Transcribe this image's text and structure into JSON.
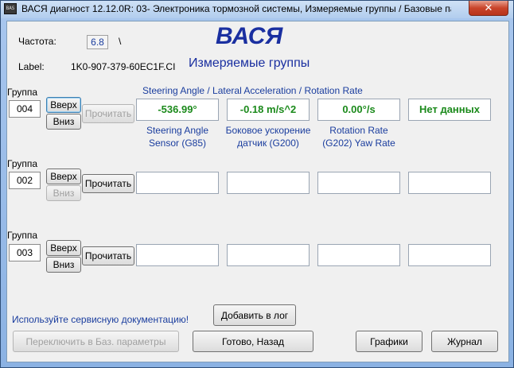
{
  "window": {
    "title": "ВАСЯ диагност 12.12.0R: 03- Электроника тормозной системы,  Измеряемые группы / Базовые пара...",
    "icon_text": "BAS",
    "close_glyph": "✕"
  },
  "header": {
    "freq_label": "Частота:",
    "freq_value": "6.8",
    "freq_suffix": "\\",
    "label_label": "Label:",
    "label_value": "1K0-907-379-60EC1F.CI",
    "brand": "ВАСЯ",
    "subtitle": "Измеряемые группы"
  },
  "group1": {
    "label": "Группа",
    "number": "004",
    "up": "Вверх",
    "down": "Вниз",
    "read": "Прочитать",
    "title": "Steering Angle / Lateral Acceleration / Rotation Rate",
    "fields": [
      "-536.99°",
      "-0.18 m/s^2",
      "0.00°/s",
      "Нет данных"
    ],
    "captions": [
      [
        "Steering Angle",
        "Sensor (G85)"
      ],
      [
        "Боковое ускорение",
        "датчик (G200)"
      ],
      [
        "Rotation Rate",
        "(G202) Yaw Rate"
      ]
    ]
  },
  "group2": {
    "label": "Группа",
    "number": "002",
    "up": "Вверх",
    "down": "Вниз",
    "read": "Прочитать"
  },
  "group3": {
    "label": "Группа",
    "number": "003",
    "up": "Вверх",
    "down": "Вниз",
    "read": "Прочитать"
  },
  "footer": {
    "note": "Используйте сервисную документацию!",
    "add_log": "Добавить в лог",
    "switch_basic": "Переключить в Баз. параметры",
    "done_back": "Готово, Назад",
    "graphs": "Графики",
    "journal": "Журнал"
  },
  "colors": {
    "value_green": "#1b8a1b",
    "label_blue": "#1a3d9e",
    "close_red": "#c9452b"
  }
}
